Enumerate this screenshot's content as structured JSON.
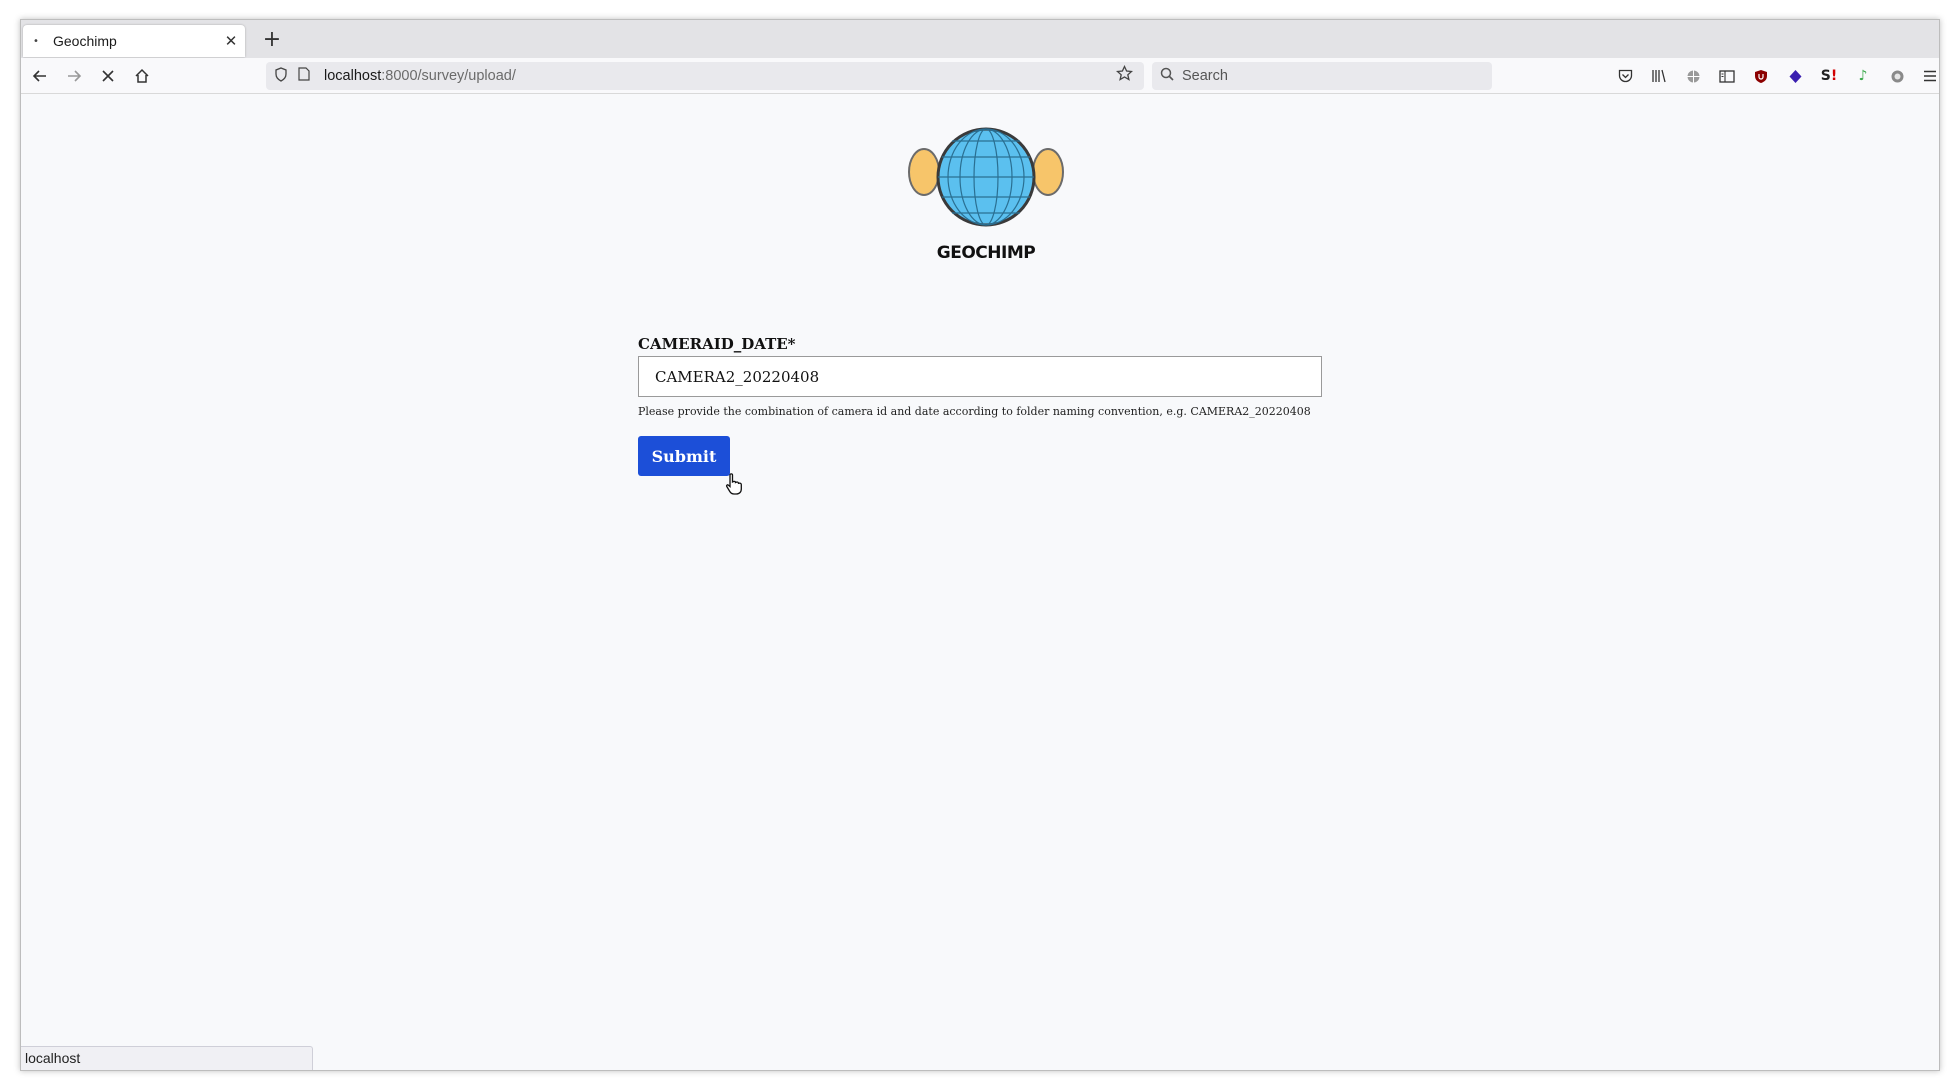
{
  "browser": {
    "tab_title": "Geochimp",
    "url_host": "localhost",
    "url_rest": ":8000/survey/upload/",
    "search_placeholder": "Search",
    "status_text": "localhost"
  },
  "page": {
    "logo_text": "GEOCHIMP",
    "field_label": "CAMERAID_DATE*",
    "field_value": "CAMERA2_20220408",
    "help_text": "Please provide the combination of camera id and date according to folder naming convention, e.g. CAMERA2_20220408",
    "submit_label": "Submit"
  },
  "colors": {
    "accent": "#1c4fd8",
    "globe": "#5bc0ef",
    "ears": "#f7c56a"
  }
}
